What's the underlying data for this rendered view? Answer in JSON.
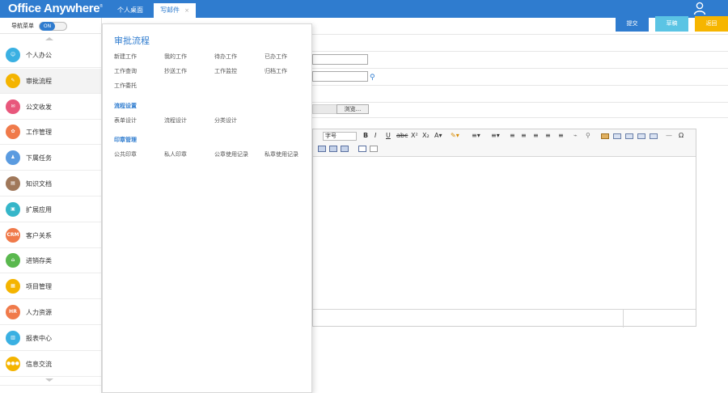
{
  "app": {
    "logo": "Office Anywhere",
    "logo_mark": "®",
    "tabs": [
      {
        "label": "个人桌面",
        "active": false
      },
      {
        "label": "写邮件",
        "active": true,
        "close": "×"
      }
    ],
    "user_icon": "user-icon"
  },
  "sidebar": {
    "toggle_label": "导航菜单",
    "toggle_state": "ON",
    "items": [
      {
        "label": "个人办公",
        "icon": "person",
        "color": "#3ab0e2",
        "glyph": "☺"
      },
      {
        "label": "审批流程",
        "icon": "approval",
        "color": "#f4b400",
        "glyph": "✎",
        "active": true
      },
      {
        "label": "公文收发",
        "icon": "documents",
        "color": "#e8577c",
        "glyph": "✉"
      },
      {
        "label": "工作管理",
        "icon": "work",
        "color": "#f07a4a",
        "glyph": "✿"
      },
      {
        "label": "下属任务",
        "icon": "team",
        "color": "#5a9be0",
        "glyph": "♟"
      },
      {
        "label": "知识文档",
        "icon": "book",
        "color": "#a0785a",
        "glyph": "▤"
      },
      {
        "label": "扩展应用",
        "icon": "monitor",
        "color": "#35b6c9",
        "glyph": "▣"
      },
      {
        "label": "客户关系",
        "icon": "crm",
        "color": "#f07a4a",
        "glyph": "CRM"
      },
      {
        "label": "进销存类",
        "icon": "store",
        "color": "#5ab84e",
        "glyph": "⌂"
      },
      {
        "label": "项目管理",
        "icon": "project",
        "color": "#f4b400",
        "glyph": "▦"
      },
      {
        "label": "人力资源",
        "icon": "hr",
        "color": "#f07a4a",
        "glyph": "HR"
      },
      {
        "label": "报表中心",
        "icon": "chart",
        "color": "#3ab0e2",
        "glyph": "▥"
      },
      {
        "label": "信息交流",
        "icon": "message",
        "color": "#f4b400",
        "glyph": "●●●"
      }
    ]
  },
  "toolbar": {
    "submit_label": "提交",
    "draft_label": "草稿",
    "back_label": "返回",
    "browse_label": "浏览...",
    "font_size_label": "字号"
  },
  "menu": {
    "title": "审批流程",
    "links_workflow": [
      "新建工作",
      "我的工作",
      "待办工作",
      "已办工作",
      "工作查询",
      "抄送工作",
      "工作监控",
      "归档工作",
      "工作委托"
    ],
    "section_design": "流程设置",
    "links_design": [
      "表单设计",
      "流程设计",
      "分类设计"
    ],
    "section_seal": "印章管理",
    "links_seal": [
      "公共印章",
      "私人印章",
      "公章使用记录",
      "私章使用记录"
    ]
  }
}
